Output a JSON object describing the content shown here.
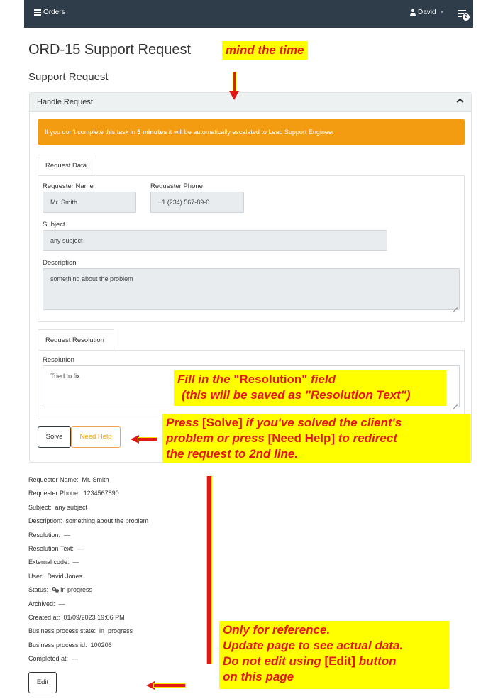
{
  "navbar": {
    "brand": "Orders",
    "user": "David",
    "notifications_count": "2"
  },
  "page": {
    "title": "ORD-15 Support Request",
    "subtitle": "Support Request"
  },
  "panel": {
    "title": "Handle Request",
    "alert": {
      "prefix": "If you don't complete this task in ",
      "strong": "5 minutes",
      "suffix": " it will be automatically escalated to Lead Support Engineer"
    }
  },
  "request_data": {
    "tab": "Request Data",
    "requester_name_label": "Requester Name",
    "requester_name_value": "Mr. Smith",
    "requester_phone_label": "Requester Phone",
    "requester_phone_value": "+1 (234) 567-89-0",
    "subject_label": "Subject",
    "subject_value": "any subject",
    "description_label": "Description",
    "description_value": "something about the problem"
  },
  "resolution": {
    "tab": "Request Resolution",
    "label": "Resolution",
    "value": "Tried to fix"
  },
  "buttons": {
    "solve": "Solve",
    "need_help": "Need Help",
    "edit": "Edit"
  },
  "info": [
    {
      "key": "Requester Name:",
      "value": "Mr. Smith"
    },
    {
      "key": "Requester Phone:",
      "value": "1234567890"
    },
    {
      "key": "Subject:",
      "value": "any subject"
    },
    {
      "key": "Description:",
      "value": "something about the problem"
    },
    {
      "key": "Resolution:",
      "value": "—"
    },
    {
      "key": "Resolution Text:",
      "value": "—"
    },
    {
      "key": "External code:",
      "value": "—"
    },
    {
      "key": "User:",
      "value": "David Jones"
    },
    {
      "key": "Status:",
      "value": "In progress"
    },
    {
      "key": "Archived:",
      "value": "—"
    },
    {
      "key": "Created at:",
      "value": "01/09/2023 19:06 PM"
    },
    {
      "key": "Business process state:",
      "value": "in_progress"
    },
    {
      "key": "Business process id:",
      "value": "100206"
    },
    {
      "key": "Completed at:",
      "value": "—"
    }
  ],
  "annotations": {
    "time": "mind the time",
    "resolution_line1_a": "Fill in the ",
    "resolution_line1_b": "\"Resolution\"",
    "resolution_line1_c": " field",
    "resolution_line2": "(this will be saved as \"Resolution Text\")",
    "buttons_line1_a": "Press ",
    "buttons_line1_b": "[Solve]",
    "buttons_line1_c": " if you've solved the client's",
    "buttons_line2_a": "problem   or   press ",
    "buttons_line2_b": "[Need Help]",
    "buttons_line2_c": " to redirect",
    "buttons_line3": "the request to 2nd line.",
    "ref_line1": "Only for reference.",
    "ref_line2": "Update page to see actual data.",
    "ref_line3_a": "Do not edit using ",
    "ref_line3_b": "[Edit]",
    "ref_line3_c": " button",
    "ref_line4": "on  this page"
  }
}
